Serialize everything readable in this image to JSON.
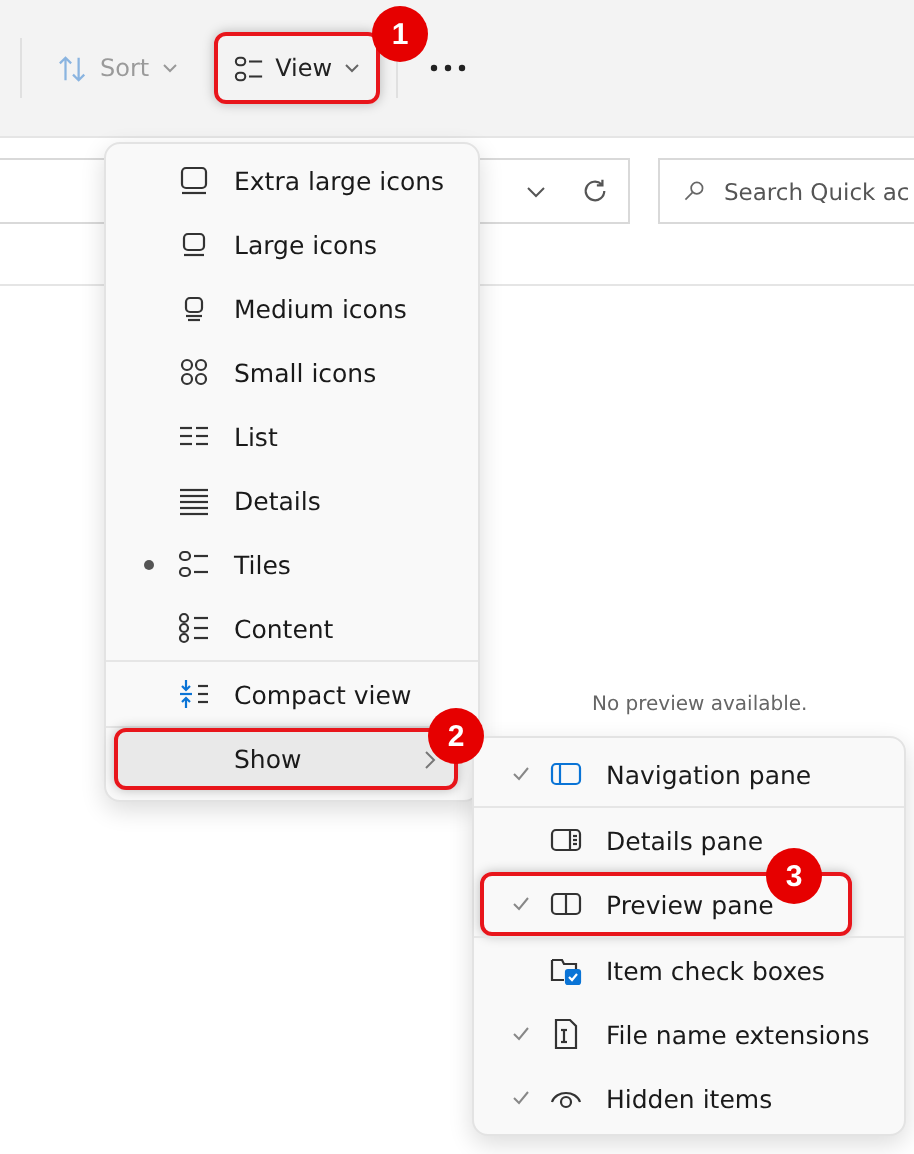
{
  "toolbar": {
    "sort": "Sort",
    "view": "View"
  },
  "search": {
    "placeholder": "Search Quick ac"
  },
  "preview_message": "No preview available.",
  "view_menu": {
    "items": [
      {
        "label": "Extra large icons",
        "selected": false
      },
      {
        "label": "Large icons",
        "selected": false
      },
      {
        "label": "Medium icons",
        "selected": false
      },
      {
        "label": "Small icons",
        "selected": false
      },
      {
        "label": "List",
        "selected": false
      },
      {
        "label": "Details",
        "selected": false
      },
      {
        "label": "Tiles",
        "selected": true
      },
      {
        "label": "Content",
        "selected": false
      },
      {
        "label": "Compact view",
        "selected": false
      }
    ],
    "show": "Show"
  },
  "show_menu": {
    "items": [
      {
        "label": "Navigation pane",
        "checked": true
      },
      {
        "label": "Details pane",
        "checked": false
      },
      {
        "label": "Preview pane",
        "checked": true
      },
      {
        "label": "Item check boxes",
        "checked": false
      },
      {
        "label": "File name extensions",
        "checked": true
      },
      {
        "label": "Hidden items",
        "checked": true
      }
    ]
  },
  "annotations": [
    {
      "label": "1"
    },
    {
      "label": "2"
    },
    {
      "label": "3"
    }
  ]
}
